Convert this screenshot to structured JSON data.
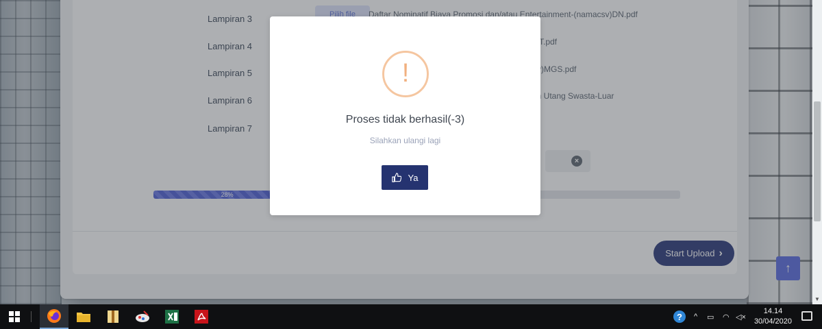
{
  "upload_form": {
    "rows": [
      {
        "label": "Lampiran 3",
        "file": "Daftar Nominatif Biaya Promosi dan/atau Entertainment-(namacsv)DN.pdf"
      },
      {
        "label": "Lampiran 4",
        "file": "T.pdf"
      },
      {
        "label": "Lampiran 5",
        "file": "sv)MGS.pdf"
      },
      {
        "label": "Lampiran 6",
        "file": "ran Utang Swasta-Luar"
      },
      {
        "label": "Lampiran 7",
        "file": ""
      }
    ],
    "choose_file_label": "Pilih file",
    "progress": {
      "percent": 28,
      "label": "28%"
    },
    "start_upload_label": "Start Upload"
  },
  "modal": {
    "icon": "exclamation-icon",
    "title": "Proses tidak berhasil(-3)",
    "message": "Silahkan ulangi lagi",
    "ok_label": "Ya",
    "ok_icon": "thumbs-up-icon"
  },
  "colors": {
    "primary": "#253370",
    "warning": "#f5c6a0",
    "progress": "#4f5fd6"
  },
  "taskbar": {
    "apps": [
      "firefox",
      "file-explorer",
      "archive",
      "paint",
      "excel",
      "acrobat-reader"
    ],
    "time": "14.14",
    "date": "30/04/2020"
  }
}
